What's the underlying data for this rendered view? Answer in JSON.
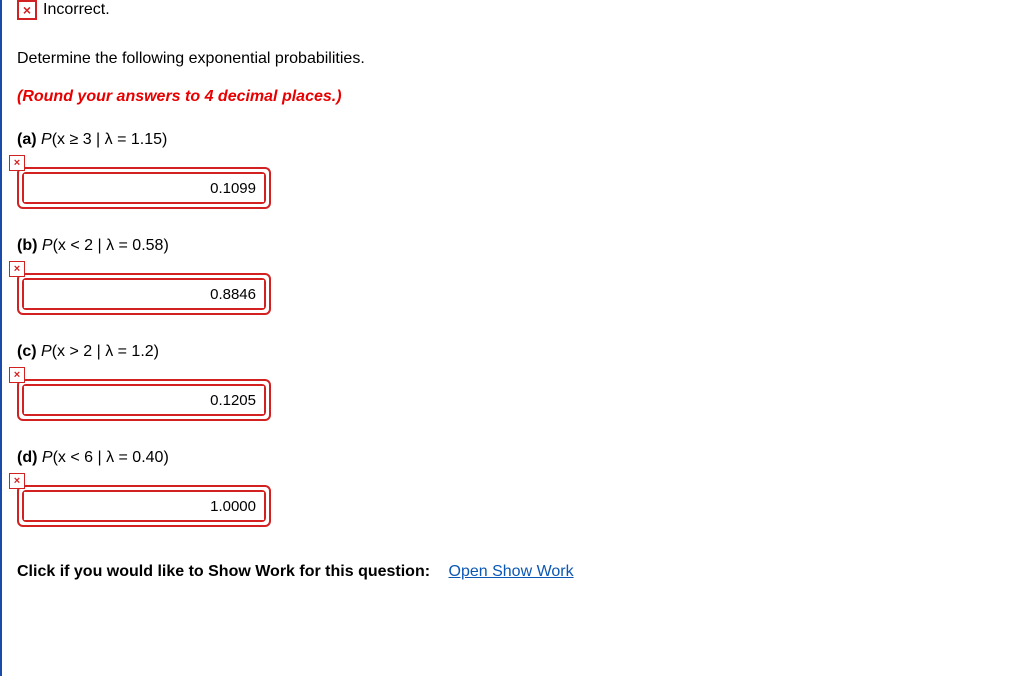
{
  "status": {
    "icon": "×",
    "text": "Incorrect."
  },
  "question": "Determine the following exponential probabilities.",
  "instruction": "(Round your answers to 4 decimal places.)",
  "parts": {
    "a": {
      "label": "(a)",
      "expr_prefix": "P",
      "expr_body": "(x ≥ 3 | λ = 1.15)",
      "marker": "×",
      "answer": "0.1099"
    },
    "b": {
      "label": "(b)",
      "expr_prefix": "P",
      "expr_body": "(x < 2 | λ = 0.58)",
      "marker": "×",
      "answer": "0.8846"
    },
    "c": {
      "label": "(c)",
      "expr_prefix": "P",
      "expr_body": "(x > 2 | λ = 1.2)",
      "marker": "×",
      "answer": "0.1205"
    },
    "d": {
      "label": "(d)",
      "expr_prefix": "P",
      "expr_body": "(x < 6 | λ = 0.40)",
      "marker": "×",
      "answer": "1.0000"
    }
  },
  "show_work": {
    "prompt": "Click if you would like to Show Work for this question:",
    "link": "Open Show Work"
  }
}
